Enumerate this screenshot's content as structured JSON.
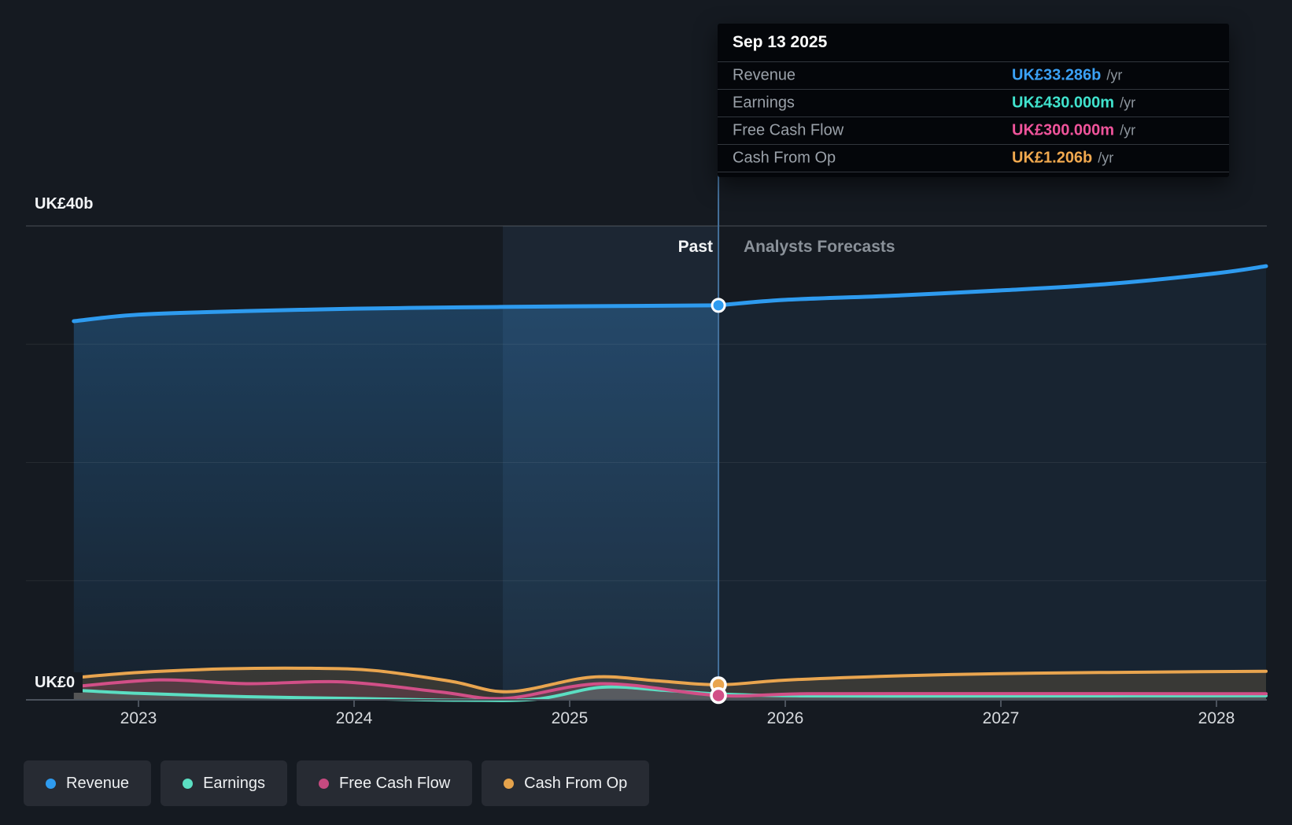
{
  "tooltip": {
    "date": "Sep 13 2025",
    "rows": [
      {
        "label": "Revenue",
        "value": "UK£33.286b",
        "suffix": "/yr",
        "color": "#3ba1f5"
      },
      {
        "label": "Earnings",
        "value": "UK£430.000m",
        "suffix": "/yr",
        "color": "#40e2cd"
      },
      {
        "label": "Free Cash Flow",
        "value": "UK£300.000m",
        "suffix": "/yr",
        "color": "#ef549b"
      },
      {
        "label": "Cash From Op",
        "value": "UK£1.206b",
        "suffix": "/yr",
        "color": "#f1a94f"
      }
    ]
  },
  "axis": {
    "y_top_label": "UK£40b",
    "y_zero_label": "UK£0",
    "x_labels": [
      "2023",
      "2024",
      "2025",
      "2026",
      "2027",
      "2028"
    ]
  },
  "sections": {
    "past_label": "Past",
    "forecast_label": "Analysts Forecasts"
  },
  "legend": [
    {
      "label": "Revenue",
      "color": "#2e9bef"
    },
    {
      "label": "Earnings",
      "color": "#5bdec2"
    },
    {
      "label": "Free Cash Flow",
      "color": "#c64a80"
    },
    {
      "label": "Cash From Op",
      "color": "#e5a34c"
    }
  ],
  "chart_data": {
    "type": "line",
    "title": "Earnings and Revenue Growth",
    "x_unit": "year",
    "xlim": [
      2022.7,
      2028.23
    ],
    "ylim": [
      0,
      40
    ],
    "y_axis_labels_b": [
      0,
      40
    ],
    "y_gridlines_b": [
      10,
      20,
      30,
      40
    ],
    "x_ticks": [
      2023,
      2024,
      2025,
      2026,
      2027,
      2028
    ],
    "currency": "UK£ (billions)",
    "divider_x": 2025.69,
    "divider_date": "Sep 13 2025",
    "hover_band": [
      2024.69,
      2025.69
    ],
    "grid": true,
    "legend_position": "bottom-left",
    "series": [
      {
        "name": "Revenue",
        "color": "#2e9bef",
        "x": [
          2022.7,
          2023.0,
          2023.5,
          2024.0,
          2024.5,
          2025.0,
          2025.69,
          2026.0,
          2026.5,
          2027.0,
          2027.5,
          2028.0,
          2028.23
        ],
        "y": [
          31.95,
          32.5,
          32.8,
          33.0,
          33.12,
          33.2,
          33.286,
          33.75,
          34.1,
          34.55,
          35.1,
          36.0,
          36.6
        ]
      },
      {
        "name": "Earnings",
        "color": "#5bdec2",
        "x": [
          2022.7,
          2023.0,
          2023.5,
          2024.0,
          2024.5,
          2024.85,
          2025.15,
          2025.45,
          2025.69,
          2026.0,
          2026.5,
          2027.5,
          2028.23
        ],
        "y": [
          0.75,
          0.48,
          0.2,
          0.05,
          -0.1,
          0.0,
          1.0,
          0.72,
          0.43,
          0.28,
          0.25,
          0.27,
          0.28
        ]
      },
      {
        "name": "Free Cash Flow",
        "color": "#d14f87",
        "x": [
          2022.7,
          2023.1,
          2023.5,
          2023.95,
          2024.4,
          2024.7,
          2025.15,
          2025.69,
          2026.1,
          2027.0,
          2028.23
        ],
        "y": [
          1.05,
          1.62,
          1.3,
          1.45,
          0.6,
          0.05,
          1.3,
          0.3,
          0.45,
          0.46,
          0.45
        ]
      },
      {
        "name": "Cash From Op",
        "color": "#e9a54f",
        "x": [
          2022.7,
          2023.0,
          2023.4,
          2023.8,
          2024.1,
          2024.45,
          2024.72,
          2025.1,
          2025.4,
          2025.69,
          2026.0,
          2026.5,
          2027.0,
          2027.5,
          2028.23
        ],
        "y": [
          1.8,
          2.25,
          2.55,
          2.6,
          2.4,
          1.5,
          0.62,
          1.85,
          1.55,
          1.206,
          1.6,
          1.95,
          2.15,
          2.25,
          2.35
        ]
      }
    ],
    "markers_at_divider": [
      {
        "series": "Revenue",
        "value_b": 33.286
      },
      {
        "series": "Cash From Op",
        "value_b": 1.206
      },
      {
        "series": "Free Cash Flow",
        "value_b": 0.3
      }
    ]
  }
}
